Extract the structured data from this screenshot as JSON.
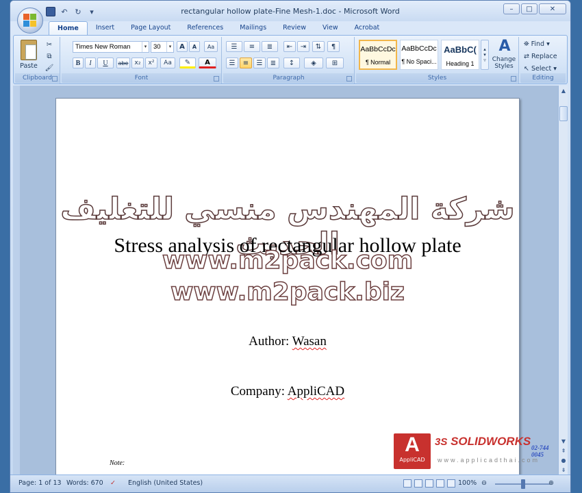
{
  "window": {
    "title": "rectangular hollow plate-Fine Mesh-1.doc - Microsoft Word",
    "controls": {
      "minimize": "–",
      "maximize": "□",
      "close": "✕"
    }
  },
  "qat": {
    "save": "save-icon",
    "undo": "↶",
    "redo": "↻",
    "more": "▾"
  },
  "tabs": [
    "Home",
    "Insert",
    "Page Layout",
    "References",
    "Mailings",
    "Review",
    "View",
    "Acrobat"
  ],
  "ribbon": {
    "clipboard": {
      "paste": "Paste",
      "label": "Clipboard"
    },
    "font": {
      "name": "Times New Roman",
      "size": "30",
      "grow": "A",
      "shrink": "A",
      "clear": "Aa",
      "bold": "B",
      "italic": "I",
      "underline": "U",
      "strike": "abe",
      "subscript": "x₂",
      "superscript": "x²",
      "case": "Aa",
      "label": "Font"
    },
    "paragraph": {
      "label": "Paragraph",
      "show_marks": "¶"
    },
    "styles": {
      "items": [
        {
          "sample": "AaBbCcDc",
          "name": "¶ Normal"
        },
        {
          "sample": "AaBbCcDc",
          "name": "¶ No Spaci..."
        },
        {
          "sample": "AaBbC(",
          "name": "Heading 1"
        }
      ],
      "change_styles": "Change Styles",
      "label": "Styles"
    },
    "editing": {
      "find": "Find",
      "replace": "Replace",
      "select": "Select",
      "label": "Editing"
    }
  },
  "document": {
    "arabic_watermark": "شركة المهندس منسي للتغليف الحديث",
    "title": "Stress analysis of rectangular hollow plate",
    "watermark_1": "www.m2pack.com",
    "watermark_2": "www.m2pack.biz",
    "author_label": "Author: ",
    "author_name": "Wasan",
    "company_label": "Company: ",
    "company_name": "AppliCAD",
    "note": "Note:",
    "logo_applicad": "AppliCAD",
    "logo_solidworks": "SOLIDWORKS",
    "logo_ds": "3S",
    "logo_url": "www.applicadthai.com",
    "logo_phone": "02-744 0045"
  },
  "statusbar": {
    "page": "Page: 1 of 13",
    "words": "Words: 670",
    "language": "English (United States)",
    "zoom": "100%"
  }
}
